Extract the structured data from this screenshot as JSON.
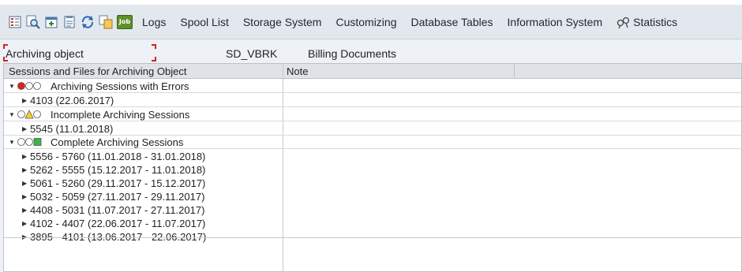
{
  "toolbar": {
    "icons": [
      "overview-icon",
      "search-icon",
      "add-icon",
      "document-icon",
      "refresh-icon",
      "copy-icon",
      "job-icon"
    ],
    "job_label": "Job",
    "menu": [
      "Logs",
      "Spool List",
      "Storage System",
      "Customizing",
      "Database Tables",
      "Information System",
      "Statistics"
    ]
  },
  "field": {
    "label": "Archiving object",
    "value": "SD_VBRK",
    "description": "Billing Documents"
  },
  "tree": {
    "columns": [
      "Sessions and Files for Archiving Object",
      "Note"
    ],
    "groups": [
      {
        "label": "Archiving Sessions with Errors",
        "status": "error",
        "items": [
          "4103 (22.06.2017)"
        ]
      },
      {
        "label": "Incomplete Archiving Sessions",
        "status": "warning",
        "items": [
          "5545 (11.01.2018)"
        ]
      },
      {
        "label": "Complete Archiving Sessions",
        "status": "ok",
        "items": [
          "5556 - 5760 (11.01.2018 - 31.01.2018)",
          "5262 - 5555 (15.12.2017 - 11.01.2018)",
          "5061 - 5260 (29.11.2017 - 15.12.2017)",
          "5032 - 5059 (27.11.2017 - 29.11.2017)",
          "4408 - 5031 (11.07.2017 - 27.11.2017)",
          "4102 - 4407 (22.06.2017 - 11.07.2017)",
          "3895 - 4101 (13.06.2017 - 22.06.2017)"
        ]
      }
    ]
  },
  "colors": {
    "error": "#e02020",
    "warning": "#f2d22a",
    "ok": "#3bb54a",
    "field_marker": "#d62020"
  }
}
